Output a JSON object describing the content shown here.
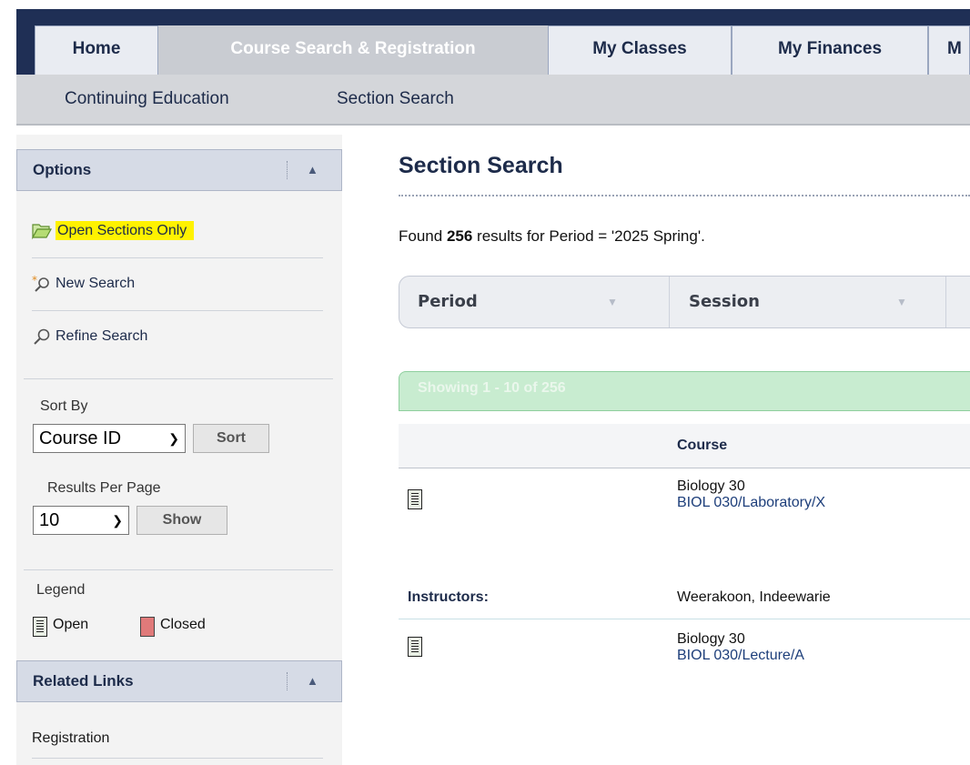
{
  "nav": {
    "tabs": [
      {
        "label": "Home",
        "active": false
      },
      {
        "label": "Course Search & Registration",
        "active": true
      },
      {
        "label": "My Classes",
        "active": false
      },
      {
        "label": "My Finances",
        "active": false
      },
      {
        "label": "M",
        "active": false
      }
    ],
    "subnav": [
      "Continuing Education",
      "Section Search"
    ]
  },
  "sidebar": {
    "options_title": "Options",
    "options": [
      {
        "label": "Open Sections Only",
        "icon": "folder-open-icon",
        "highlighted": true
      },
      {
        "label": "New Search",
        "icon": "new-search-icon"
      },
      {
        "label": "Refine Search",
        "icon": "magnifier-icon"
      }
    ],
    "sort_by_label": "Sort By",
    "sort_by_value": "Course ID",
    "sort_button": "Sort",
    "results_per_page_label": "Results Per Page",
    "results_per_page_value": "10",
    "show_button": "Show",
    "legend_label": "Legend",
    "legend_open": "Open",
    "legend_closed": "Closed",
    "related_links_title": "Related Links",
    "related_links": [
      "Registration"
    ]
  },
  "main": {
    "title": "Section Search",
    "found_prefix": "Found ",
    "found_count": "256",
    "found_suffix": " results for Period = '2025 Spring'.",
    "filter_columns": [
      "Period",
      "Session"
    ],
    "showing": "Showing 1 - 10 of 256",
    "table_header": "Course",
    "rows": [
      {
        "course": "Biology 30",
        "section": "BIOL 030/Laboratory/X"
      },
      {
        "instructors_label": "Instructors:",
        "instructor": "Weerakoon, Indeewarie"
      },
      {
        "course": "Biology 30",
        "section": "BIOL 030/Lecture/A"
      }
    ]
  },
  "colors": {
    "nav_bg": "#1f2f55",
    "highlight": "#fff200",
    "showing_bar": "#c8ecd0",
    "closed_icon": "#e07a7a"
  }
}
